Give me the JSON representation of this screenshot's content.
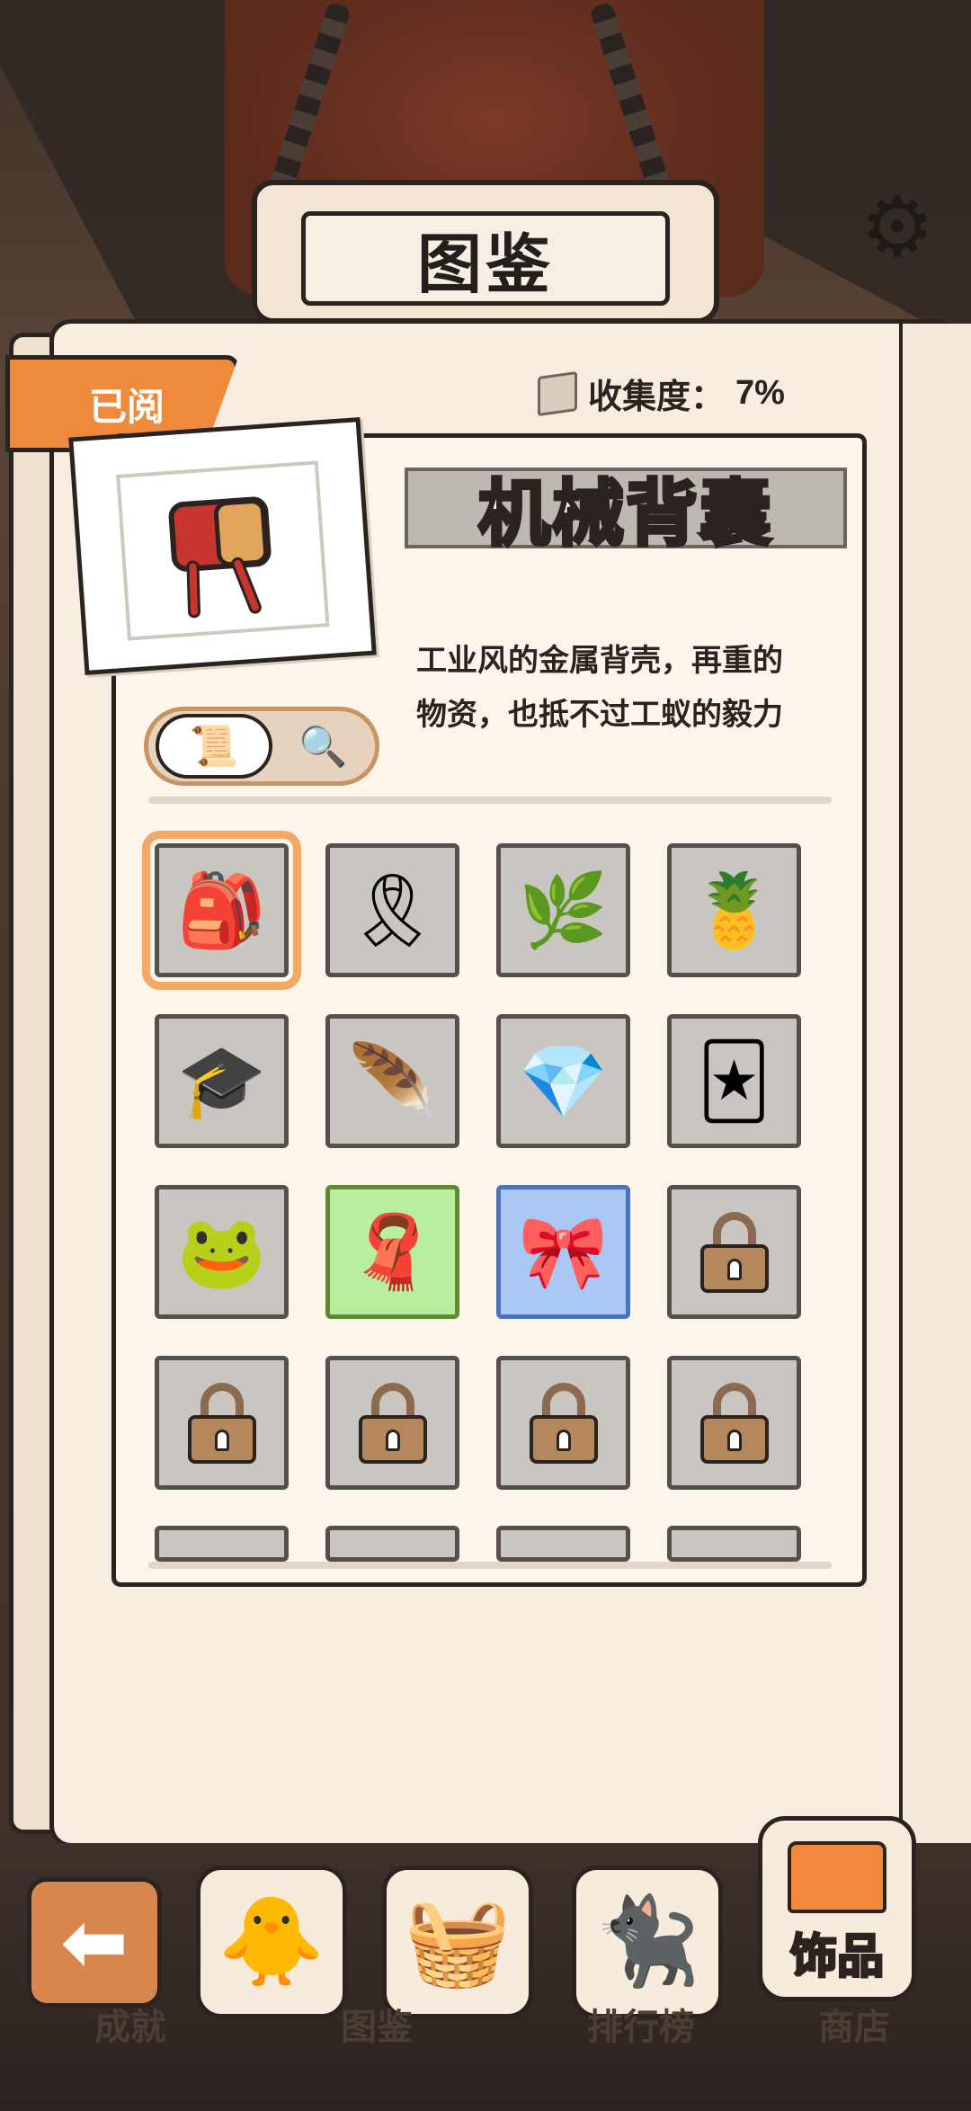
{
  "header": {
    "title": "图鉴"
  },
  "status": {
    "read_tab": "已阅",
    "collection_label": "收集度：",
    "collection_value": "7%"
  },
  "item": {
    "name": "机械背囊",
    "description_line1": "工业风的金属背壳，再重的",
    "description_line2": "物资，也抵不过工蚁的毅力",
    "icon": "backpack"
  },
  "toggle": {
    "left_icon": "certificate-icon",
    "right_icon": "magnifier-icon"
  },
  "grid": [
    {
      "icon": "🎒",
      "state": "selected"
    },
    {
      "icon": "🎗",
      "state": "normal"
    },
    {
      "icon": "🌿",
      "state": "normal"
    },
    {
      "icon": "🍍",
      "state": "normal"
    },
    {
      "icon": "🎓",
      "state": "normal"
    },
    {
      "icon": "🪶",
      "state": "normal"
    },
    {
      "icon": "💎",
      "state": "normal"
    },
    {
      "icon": "🃏",
      "state": "normal"
    },
    {
      "icon": "🐸",
      "state": "normal"
    },
    {
      "icon": "🧣",
      "state": "green"
    },
    {
      "icon": "🎀",
      "state": "blue"
    },
    {
      "icon": "lock",
      "state": "locked"
    },
    {
      "icon": "lock",
      "state": "locked"
    },
    {
      "icon": "lock",
      "state": "locked"
    },
    {
      "icon": "lock",
      "state": "locked"
    },
    {
      "icon": "lock",
      "state": "locked"
    }
  ],
  "nav": {
    "achievements": "成就",
    "collection": "图鉴",
    "ranking": "排行榜",
    "shop": "商店",
    "accessory": "饰品"
  },
  "colors": {
    "accent": "#ef8a3c",
    "panel": "#fbf5ec",
    "outline": "#2a2320"
  }
}
